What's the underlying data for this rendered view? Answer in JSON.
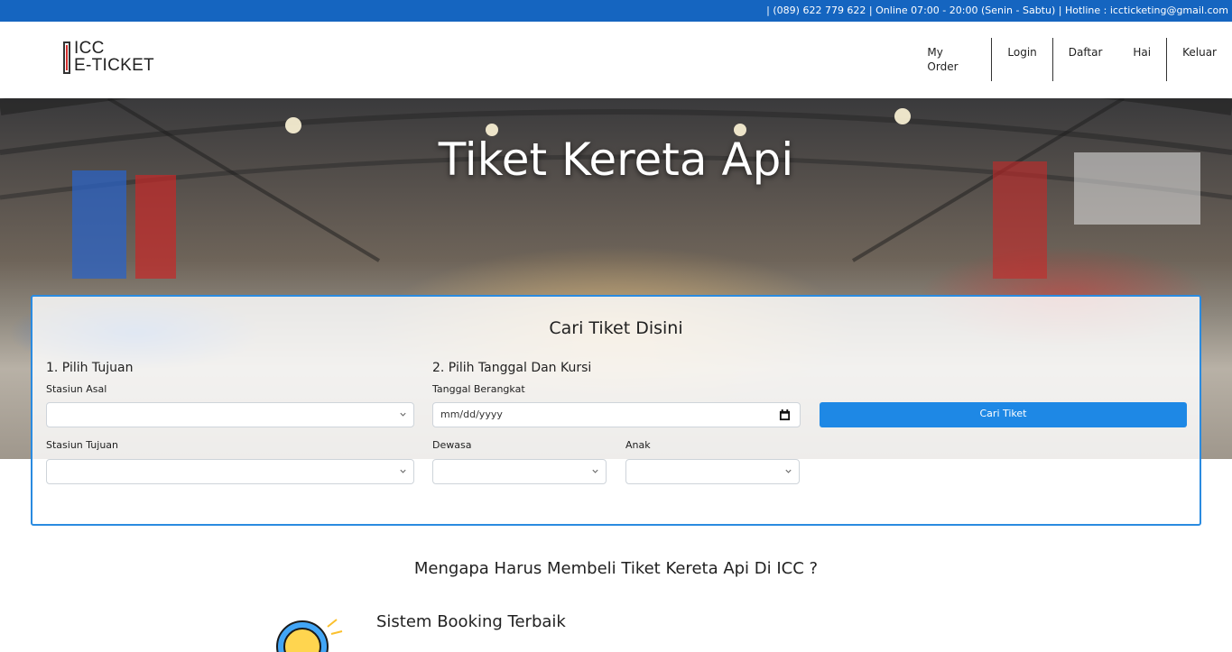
{
  "topbar": {
    "text": "| (089) 622 779 622 | Online 07:00 - 20:00 (Senin - Sabtu) | Hotline : iccticketing@gmail.com"
  },
  "logo": {
    "line1": "ICC",
    "line2": "E-TICKET"
  },
  "nav": {
    "my_order_line1": "My",
    "my_order_line2": "Order",
    "login": "Login",
    "daftar": "Daftar",
    "hai": "Hai",
    "keluar": "Keluar"
  },
  "hero": {
    "title": "Tiket Kereta Api"
  },
  "search": {
    "title": "Cari Tiket Disini",
    "section1": "1. Pilih Tujuan",
    "section2": "2. Pilih Tanggal Dan Kursi",
    "stasiun_asal_label": "Stasiun Asal",
    "stasiun_asal_value": "",
    "stasiun_tujuan_label": "Stasiun Tujuan",
    "stasiun_tujuan_value": "",
    "tanggal_label": "Tanggal Berangkat",
    "tanggal_placeholder": "mm/dd/yyyy",
    "dewasa_label": "Dewasa",
    "dewasa_value": "",
    "anak_label": "Anak",
    "anak_value": "",
    "button": "Cari Tiket"
  },
  "why": {
    "title": "Mengapa Harus Membeli Tiket Kereta Api Di ICC ?",
    "feature1_title": "Sistem Booking Terbaik"
  },
  "colors": {
    "topbar": "#1565c0",
    "accent": "#1e88e5",
    "box_border": "#2a8be0"
  }
}
